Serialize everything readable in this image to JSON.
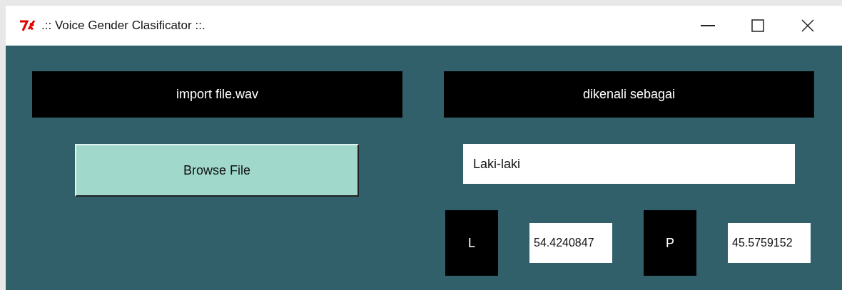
{
  "window": {
    "title": ".:: Voice Gender Clasificator ::."
  },
  "left": {
    "heading": "import file.wav",
    "button": "Browse File"
  },
  "right": {
    "heading": "dikenali sebagai",
    "result": "Laki-laki"
  },
  "scores": [
    {
      "label": "L",
      "value": "54.4240847"
    },
    {
      "label": "P",
      "value": "45.5759152"
    }
  ]
}
